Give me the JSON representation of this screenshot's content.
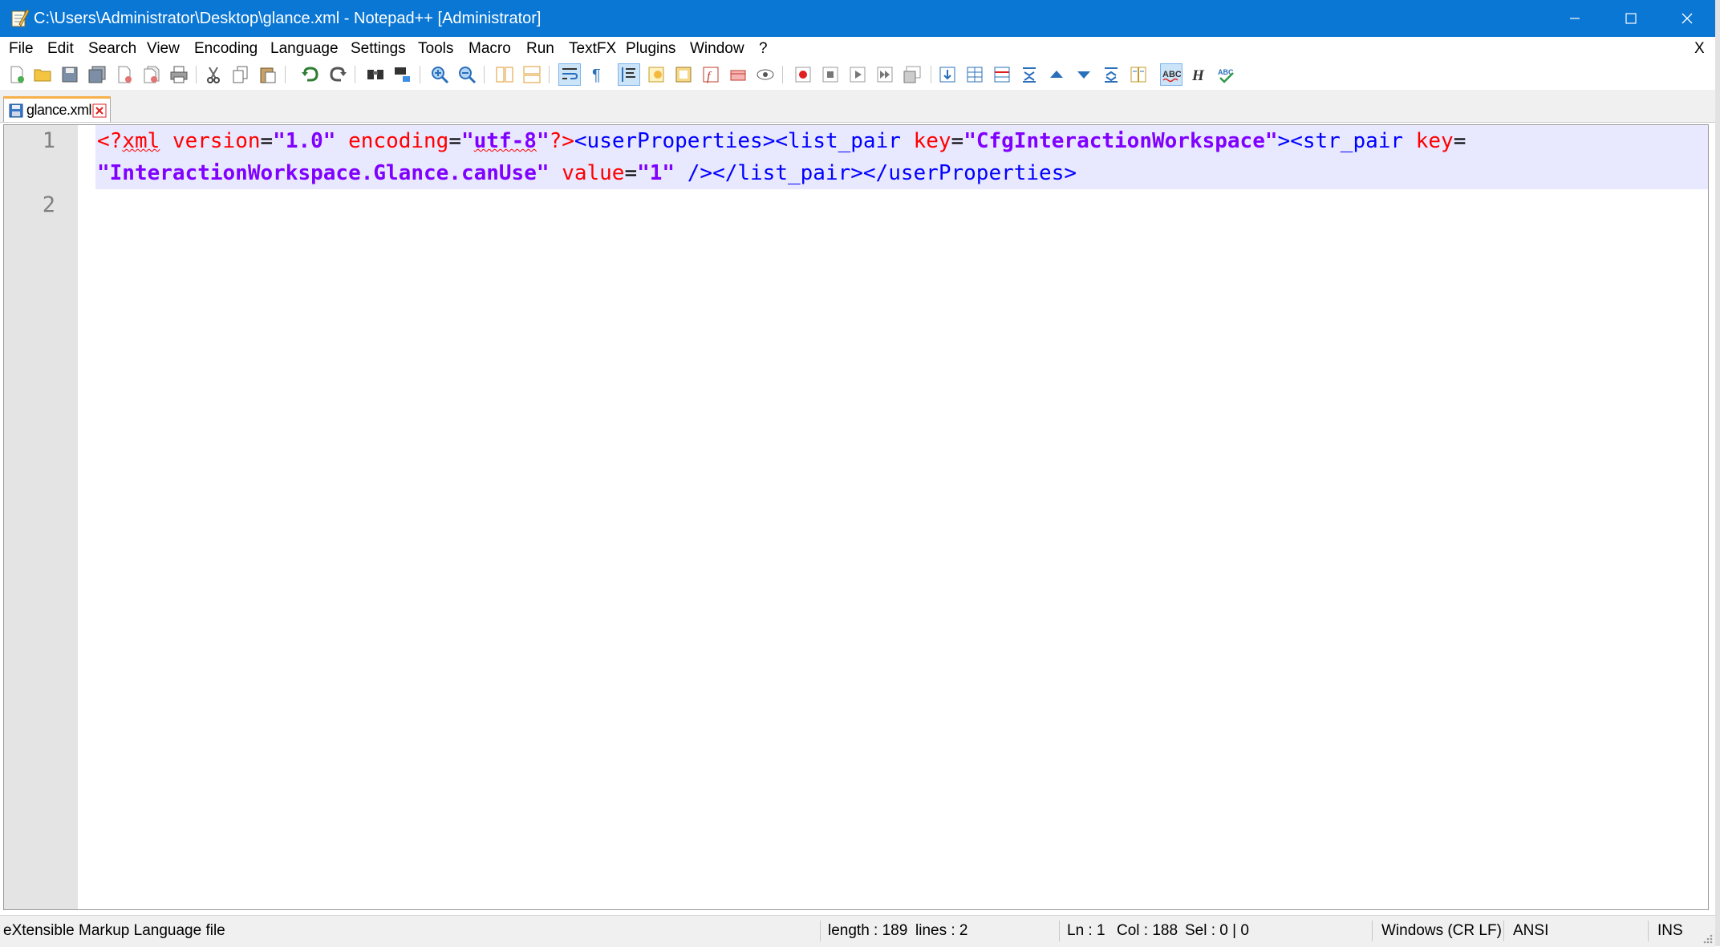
{
  "window": {
    "title": "C:\\Users\\Administrator\\Desktop\\glance.xml - Notepad++ [Administrator]",
    "title_bar_color": "#0a77d5"
  },
  "menu": {
    "items": [
      "File",
      "Edit",
      "Search",
      "View",
      "Encoding",
      "Language",
      "Settings",
      "Tools",
      "Macro",
      "Run",
      "TextFX",
      "Plugins",
      "Window",
      "?"
    ],
    "close_doc": "X"
  },
  "toolbar": {
    "icons": [
      "new-file-icon",
      "open-file-icon",
      "save-icon",
      "save-all-icon",
      "close-icon",
      "close-all-icon",
      "print-icon",
      "cut-icon",
      "copy-icon",
      "paste-icon",
      "undo-icon",
      "redo-icon",
      "find-icon",
      "replace-icon",
      "zoom-in-icon",
      "zoom-out-icon",
      "sync-vertical-icon",
      "sync-horizontal-icon",
      "word-wrap-icon",
      "show-all-chars-icon",
      "indent-guide-icon",
      "doc-map-icon",
      "folder-workspace-icon",
      "function-list-icon",
      "monitoring-icon",
      "preview-icon",
      "record-macro-icon",
      "stop-record-icon",
      "play-macro-icon",
      "run-macro-multiple-icon",
      "save-macro-icon",
      "textfx-insert-icon",
      "textfx-table-icon",
      "textfx-table-red-icon",
      "collapse-icon",
      "arrow-up-icon",
      "arrow-down-icon",
      "expand-icon",
      "columns-icon",
      "spellcheck-abc-icon",
      "html-h-icon",
      "spellcheck-check-icon"
    ]
  },
  "tabs": [
    {
      "name": "glance.xml",
      "active": true
    }
  ],
  "editor": {
    "line_numbers": [
      "1",
      "2"
    ],
    "line1a": {
      "pi_open": "<?",
      "pi_name": "xml",
      "sp1": " ",
      "attr_version": "version",
      "eq1": "=",
      "val_version": "\"1.0\"",
      "sp2": " ",
      "attr_encoding": "encoding",
      "eq2": "=",
      "val_enc_q1": "\"",
      "val_enc": "utf-8",
      "val_enc_q2": "\"",
      "pi_close": "?>",
      "tag1": "<userProperties>",
      "tag2": "<list_pair",
      "sp3": " ",
      "attr_key1": "key",
      "eq3": "=",
      "val_key1": "\"CfgInteractionWorkspace\"",
      "tag3_close": ">",
      "tag4": "<str_pair",
      "sp4": " ",
      "attr_key2": "key",
      "eq4": "="
    },
    "line1b": {
      "val_key2": "\"InteractionWorkspace.Glance.canUse\"",
      "sp1": " ",
      "attr_value": "value",
      "eq1": "=",
      "val_value": "\"1\"",
      "sp2": " ",
      "selfclose": "/>",
      "tag_end1": "</list_pair>",
      "tag_end2": "</userProperties>"
    }
  },
  "statusbar": {
    "file_type": "eXtensible Markup Language file",
    "length": "length : 189",
    "lines": "lines : 2",
    "ln": "Ln : 1",
    "col": "Col : 188",
    "sel": "Sel : 0 | 0",
    "eol": "Windows (CR LF)",
    "encoding": "ANSI",
    "mode": "INS"
  }
}
